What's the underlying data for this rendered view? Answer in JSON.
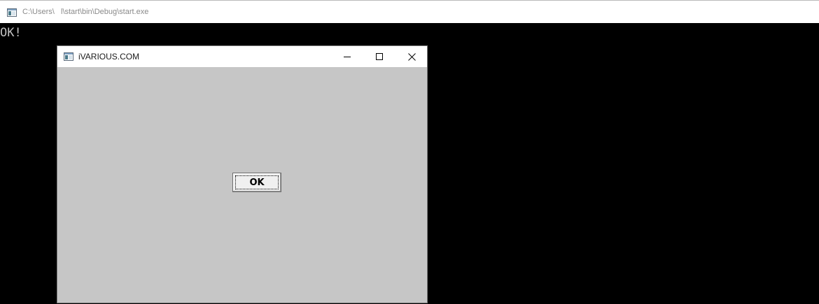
{
  "console": {
    "title": "C:\\Users\\   l\\start\\bin\\Debug\\start.exe",
    "output": "OK!"
  },
  "dialog": {
    "title": "iVARIOUS.COM",
    "ok_label": "OK"
  },
  "icons": {
    "app_icon": "console-window-icon",
    "minimize": "minimize-icon",
    "maximize": "maximize-icon",
    "close": "close-icon"
  },
  "colors": {
    "console_background": "#000000",
    "console_text": "#c0c0c0",
    "dialog_body": "#c6c6c6",
    "titlebar": "#ffffff"
  }
}
